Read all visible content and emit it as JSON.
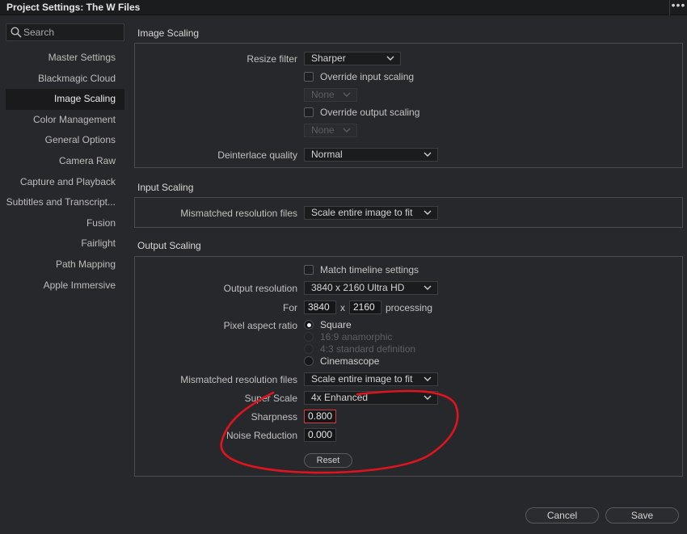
{
  "window": {
    "title": "Project Settings:  The W Files",
    "more_glyph": "•••"
  },
  "search": {
    "placeholder": "Search"
  },
  "sidebar": {
    "items": [
      {
        "label": "Master Settings"
      },
      {
        "label": "Blackmagic Cloud"
      },
      {
        "label": "Image Scaling",
        "active": true
      },
      {
        "label": "Color Management"
      },
      {
        "label": "General Options"
      },
      {
        "label": "Camera Raw"
      },
      {
        "label": "Capture and Playback"
      },
      {
        "label": "Subtitles and Transcript..."
      },
      {
        "label": "Fusion"
      },
      {
        "label": "Fairlight"
      },
      {
        "label": "Path Mapping"
      },
      {
        "label": "Apple Immersive"
      }
    ]
  },
  "image_scaling": {
    "title": "Image Scaling",
    "resize_filter_label": "Resize filter",
    "resize_filter_value": "Sharper",
    "override_input_label": "Override input scaling",
    "override_input_value": "None",
    "override_output_label": "Override output scaling",
    "override_output_value": "None",
    "deinterlace_label": "Deinterlace quality",
    "deinterlace_value": "Normal"
  },
  "input_scaling": {
    "title": "Input Scaling",
    "mismatched_label": "Mismatched resolution files",
    "mismatched_value": "Scale entire image to fit"
  },
  "output_scaling": {
    "title": "Output Scaling",
    "match_timeline_label": "Match timeline settings",
    "output_resolution_label": "Output resolution",
    "output_resolution_value": "3840 x 2160 Ultra HD",
    "for_label": "For",
    "width_value": "3840",
    "x_label": "x",
    "height_value": "2160",
    "processing_label": "processing",
    "pixel_aspect_label": "Pixel aspect ratio",
    "pixel_aspect_options": [
      {
        "label": "Square",
        "selected": true,
        "enabled": true
      },
      {
        "label": "16:9 anamorphic",
        "selected": false,
        "enabled": false
      },
      {
        "label": "4:3 standard definition",
        "selected": false,
        "enabled": false
      },
      {
        "label": "Cinemascope",
        "selected": false,
        "enabled": true
      }
    ],
    "mismatched_label": "Mismatched resolution files",
    "mismatched_value": "Scale entire image to fit",
    "super_scale_label": "Super Scale",
    "super_scale_value": "4x Enhanced",
    "sharpness_label": "Sharpness",
    "sharpness_value": "0.800",
    "noise_reduction_label": "Noise Reduction",
    "noise_reduction_value": "0.000",
    "reset_label": "Reset"
  },
  "footer": {
    "cancel_label": "Cancel",
    "save_label": "Save"
  },
  "colors": {
    "background": "#27282b",
    "annotation": "#e0141e",
    "highlight_border": "#d63a3a"
  }
}
